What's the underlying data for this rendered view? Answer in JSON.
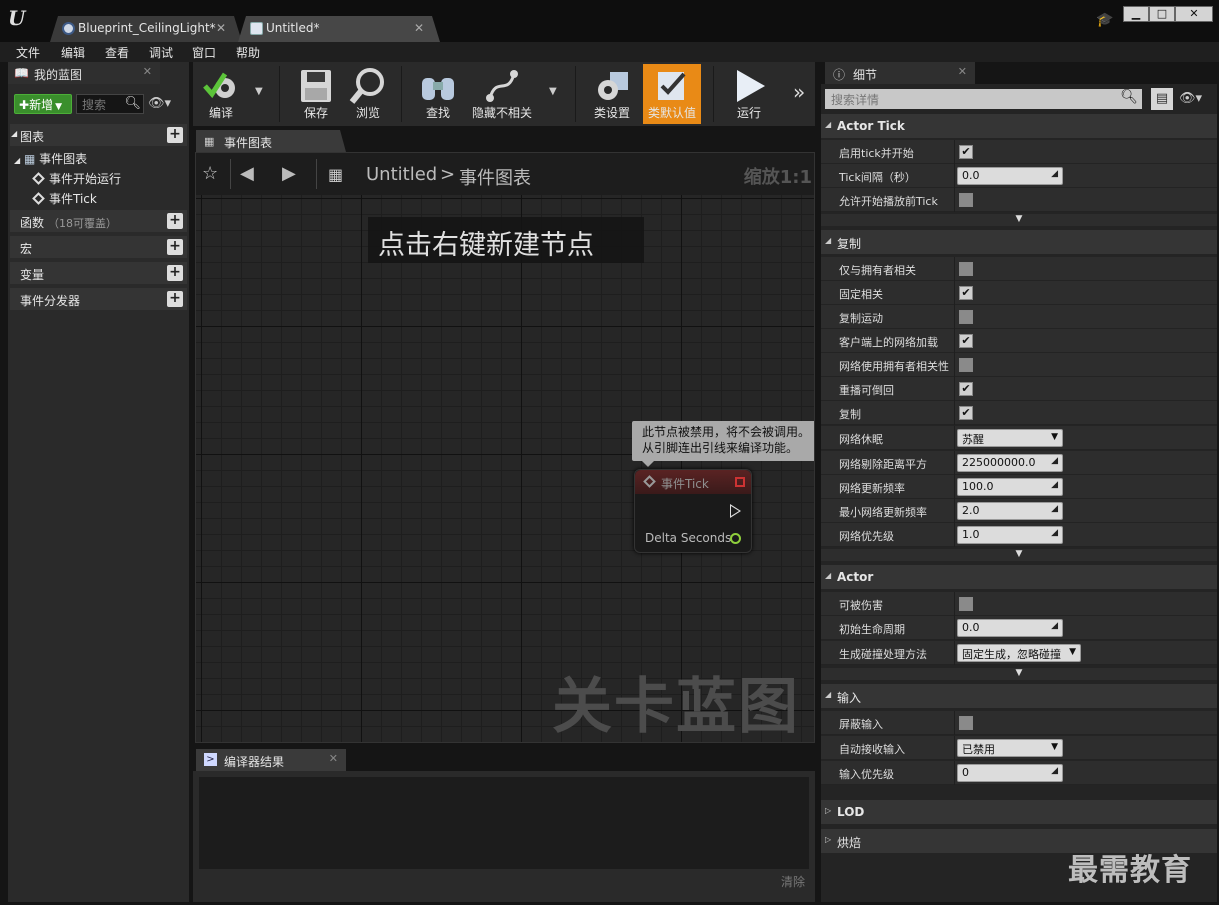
{
  "tabs": [
    {
      "label": "Blueprint_CeilingLight*"
    },
    {
      "label": "Untitled*"
    }
  ],
  "menu": [
    "文件",
    "编辑",
    "查看",
    "调试",
    "窗口",
    "帮助"
  ],
  "my_blueprint": {
    "tab_label": "我的蓝图",
    "new_label": "新增",
    "search_placeholder": "搜索",
    "sections": {
      "graphs": "图表",
      "functions": "函数",
      "functions_sub": "（18可覆盖）",
      "macros": "宏",
      "variables": "变量",
      "dispatchers": "事件分发器"
    },
    "tree": {
      "event_graph": "事件图表",
      "begin_play": "事件开始运行",
      "tick": "事件Tick"
    }
  },
  "toolbar": {
    "compile": "编译",
    "save": "保存",
    "browse": "浏览",
    "find": "查找",
    "hide_unrelated": "隐藏不相关",
    "class_settings": "类设置",
    "class_defaults": "类默认值",
    "run": "运行"
  },
  "graph": {
    "tab_label": "事件图表",
    "breadcrumb_root": "Untitled",
    "breadcrumb_sep": ">",
    "breadcrumb_leaf": "事件图表",
    "zoom": "缩放1:1",
    "hint": "点击右键新建节点",
    "watermark": "关卡蓝图",
    "tooltip_line1": "此节点被禁用，将不会被调用。",
    "tooltip_line2": "从引脚连出引线来编译功能。",
    "node_title": "事件Tick",
    "node_pin": "Delta Seconds"
  },
  "compiler": {
    "tab_label": "编译器结果",
    "clear": "清除"
  },
  "details": {
    "tab_label": "细节",
    "search_placeholder": "搜索详情",
    "cat_actor_tick": "Actor Tick",
    "tick_start": "启用tick并开始",
    "tick_interval": "Tick间隔（秒）",
    "tick_interval_val": "0.0",
    "tick_before_play": "允许开始播放前Tick",
    "cat_replication": "复制",
    "owner_only": "仅与拥有者相关",
    "always_relevant": "固定相关",
    "replicate_movement": "复制运动",
    "net_load_client": "客户端上的网络加载",
    "net_use_owner": "网络使用拥有者相关性",
    "replay_rewind": "重播可倒回",
    "replicates": "复制",
    "net_dormancy": "网络休眠",
    "net_dormancy_val": "苏醒",
    "net_cull_dist": "网络剔除距离平方",
    "net_cull_dist_val": "225000000.0",
    "net_update_freq": "网络更新频率",
    "net_update_freq_val": "100.0",
    "min_net_update_freq": "最小网络更新频率",
    "min_net_update_freq_val": "2.0",
    "net_priority": "网络优先级",
    "net_priority_val": "1.0",
    "cat_actor": "Actor",
    "can_be_damaged": "可被伤害",
    "initial_life": "初始生命周期",
    "initial_life_val": "0.0",
    "spawn_collision": "生成碰撞处理方法",
    "spawn_collision_val": "固定生成，忽略碰撞",
    "cat_input": "输入",
    "block_input": "屏蔽输入",
    "auto_receive": "自动接收输入",
    "auto_receive_val": "已禁用",
    "input_priority": "输入优先级",
    "input_priority_val": "0",
    "cat_lod": "LOD",
    "cat_bake": "烘焙"
  },
  "corner_watermark": "最需教育",
  "colors": {
    "accent_orange": "#e98a16",
    "new_green": "#3a8f2c",
    "node_header": "#5a2323",
    "float_pin": "#8fcf3c"
  }
}
